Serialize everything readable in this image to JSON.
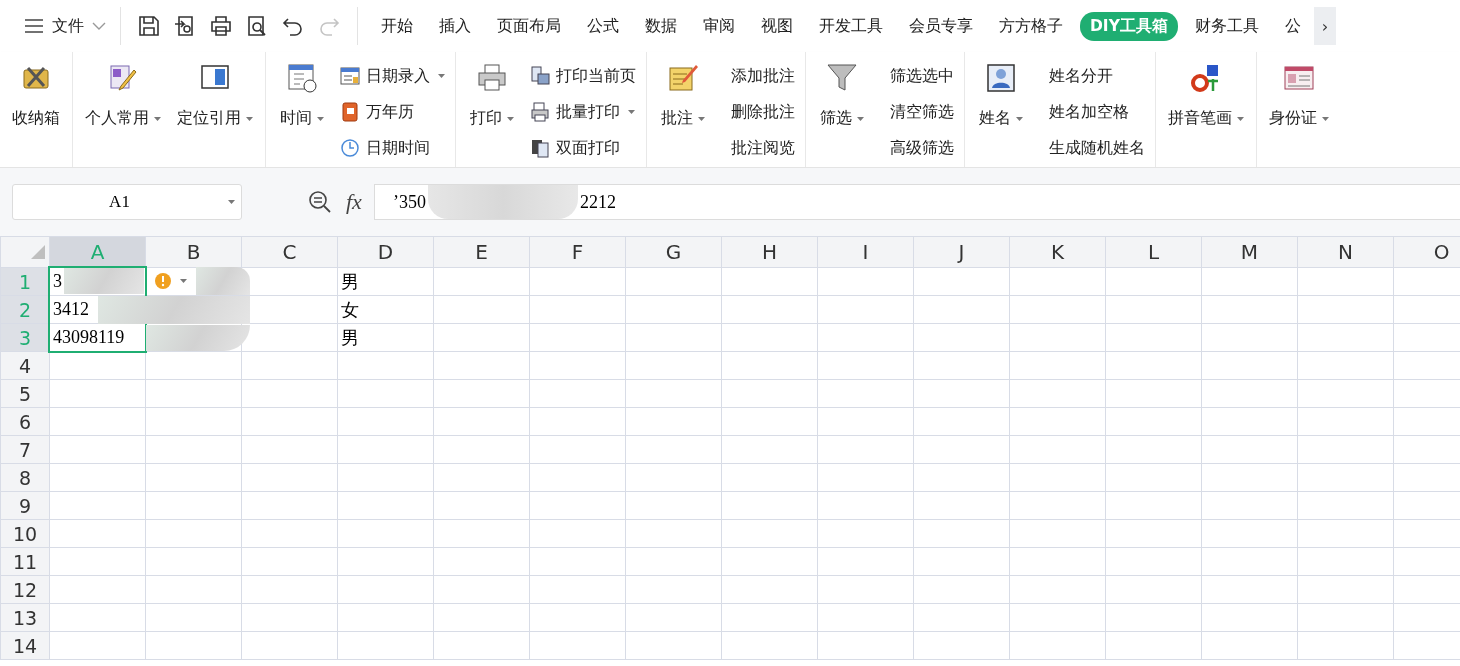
{
  "menu": {
    "label": "文件"
  },
  "quick_toolbar": [
    {
      "disabled": false
    },
    {
      "disabled": false
    },
    {
      "disabled": false
    },
    {
      "disabled": false
    },
    {
      "disabled": false
    },
    {
      "disabled": true
    }
  ],
  "tabs": [
    {
      "label": "开始",
      "selected": false
    },
    {
      "label": "插入",
      "selected": false
    },
    {
      "label": "页面布局",
      "selected": false
    },
    {
      "label": "公式",
      "selected": false
    },
    {
      "label": "数据",
      "selected": false
    },
    {
      "label": "审阅",
      "selected": false
    },
    {
      "label": "视图",
      "selected": false
    },
    {
      "label": "开发工具",
      "selected": false
    },
    {
      "label": "会员专享",
      "selected": false
    },
    {
      "label": "方方格子",
      "selected": false
    },
    {
      "label": "DIY工具箱",
      "selected": true
    },
    {
      "label": "财务工具",
      "selected": false
    },
    {
      "label": "公",
      "selected": false
    }
  ],
  "tab_scroll": "›",
  "ribbon": [
    {
      "large": [
        {
          "label": "收纳箱",
          "dropdown": false
        }
      ]
    },
    {
      "large": [
        {
          "label": "个人常用",
          "dropdown": true
        },
        {
          "label": "定位引用",
          "dropdown": true
        }
      ]
    },
    {
      "large": [
        {
          "label": "时间",
          "dropdown": true
        }
      ],
      "small": [
        {
          "label": "日期录入",
          "dropdown": true,
          "kind": "icon"
        },
        {
          "label": "万年历",
          "dropdown": false,
          "kind": "icon"
        },
        {
          "label": "日期时间",
          "dropdown": false,
          "kind": "icon"
        }
      ]
    },
    {
      "large": [
        {
          "label": "打印",
          "dropdown": true
        }
      ],
      "small": [
        {
          "label": "打印当前页",
          "dropdown": false,
          "kind": "icon"
        },
        {
          "label": "批量打印",
          "dropdown": true,
          "kind": "icon"
        },
        {
          "label": "双面打印",
          "dropdown": false,
          "kind": "icon"
        }
      ]
    },
    {
      "large": [
        {
          "label": "批注",
          "dropdown": true
        }
      ],
      "small": [
        {
          "label": "添加批注",
          "dropdown": false,
          "kind": "text"
        },
        {
          "label": "删除批注",
          "dropdown": false,
          "kind": "text"
        },
        {
          "label": "批注阅览",
          "dropdown": false,
          "kind": "text"
        }
      ]
    },
    {
      "large": [
        {
          "label": "筛选",
          "dropdown": true
        }
      ],
      "small": [
        {
          "label": "筛选选中",
          "dropdown": false,
          "kind": "text"
        },
        {
          "label": "清空筛选",
          "dropdown": false,
          "kind": "text"
        },
        {
          "label": "高级筛选",
          "dropdown": false,
          "kind": "text"
        }
      ]
    },
    {
      "large": [
        {
          "label": "姓名",
          "dropdown": true
        }
      ],
      "small": [
        {
          "label": "姓名分开",
          "dropdown": false,
          "kind": "text"
        },
        {
          "label": "姓名加空格",
          "dropdown": false,
          "kind": "text"
        },
        {
          "label": "生成随机姓名",
          "dropdown": false,
          "kind": "text"
        }
      ]
    },
    {
      "large": [
        {
          "label": "拼音笔画",
          "dropdown": true
        }
      ]
    },
    {
      "large": [
        {
          "label": "身份证",
          "dropdown": true
        }
      ]
    }
  ],
  "name_box": {
    "value": "A1"
  },
  "formula_bar": {
    "fx": "fx",
    "value_start": "’350",
    "value_end": "2212"
  },
  "sheet": {
    "columns": [
      {
        "label": "A",
        "selected": true
      },
      {
        "label": "B",
        "selected": false
      },
      {
        "label": "C",
        "selected": false
      },
      {
        "label": "D",
        "selected": false
      },
      {
        "label": "E",
        "selected": false
      },
      {
        "label": "F",
        "selected": false
      },
      {
        "label": "G",
        "selected": false
      },
      {
        "label": "H",
        "selected": false
      },
      {
        "label": "I",
        "selected": false
      },
      {
        "label": "J",
        "selected": false
      },
      {
        "label": "K",
        "selected": false
      },
      {
        "label": "L",
        "selected": false
      },
      {
        "label": "M",
        "selected": false
      },
      {
        "label": "N",
        "selected": false
      },
      {
        "label": "O",
        "selected": false
      }
    ],
    "rows": [
      {
        "label": "1",
        "selected": true,
        "col_a": "3",
        "col_d": "男"
      },
      {
        "label": "2",
        "selected": true,
        "col_a": "3412",
        "col_d": "女"
      },
      {
        "label": "3",
        "selected": true,
        "col_a": "43098119",
        "col_d": "男"
      },
      {
        "label": "4",
        "selected": false
      },
      {
        "label": "5",
        "selected": false
      },
      {
        "label": "6",
        "selected": false
      },
      {
        "label": "7",
        "selected": false
      },
      {
        "label": "8",
        "selected": false
      },
      {
        "label": "9",
        "selected": false
      },
      {
        "label": "10",
        "selected": false
      },
      {
        "label": "11",
        "selected": false
      },
      {
        "label": "12",
        "selected": false
      },
      {
        "label": "13",
        "selected": false
      },
      {
        "label": "14",
        "selected": false
      }
    ]
  }
}
